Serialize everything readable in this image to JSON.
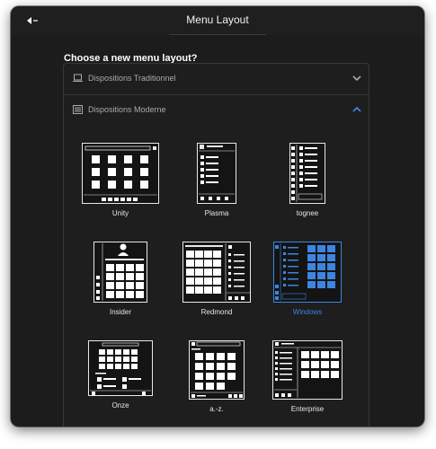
{
  "window": {
    "title": "Menu Layout"
  },
  "heading": "Choose a new menu layout?",
  "sections": [
    {
      "label": "Dispositions Traditionnel",
      "icon": "laptop-icon",
      "expanded": false
    },
    {
      "label": "Dispositions Moderne",
      "icon": "list-icon",
      "expanded": true
    }
  ],
  "layouts": [
    {
      "label": "Unity",
      "selected": false
    },
    {
      "label": "Plasma",
      "selected": false
    },
    {
      "label": "tognee",
      "selected": false
    },
    {
      "label": "Insider",
      "selected": false
    },
    {
      "label": "Redmond",
      "selected": false
    },
    {
      "label": "Windows",
      "selected": true
    },
    {
      "label": "Onze",
      "selected": false
    },
    {
      "label": "a.-z.",
      "selected": false
    },
    {
      "label": "Enterprise",
      "selected": false
    }
  ],
  "colors": {
    "accent": "#3d85e0",
    "window_bg": "#1c1c1c",
    "text": "#e6e6e6"
  }
}
